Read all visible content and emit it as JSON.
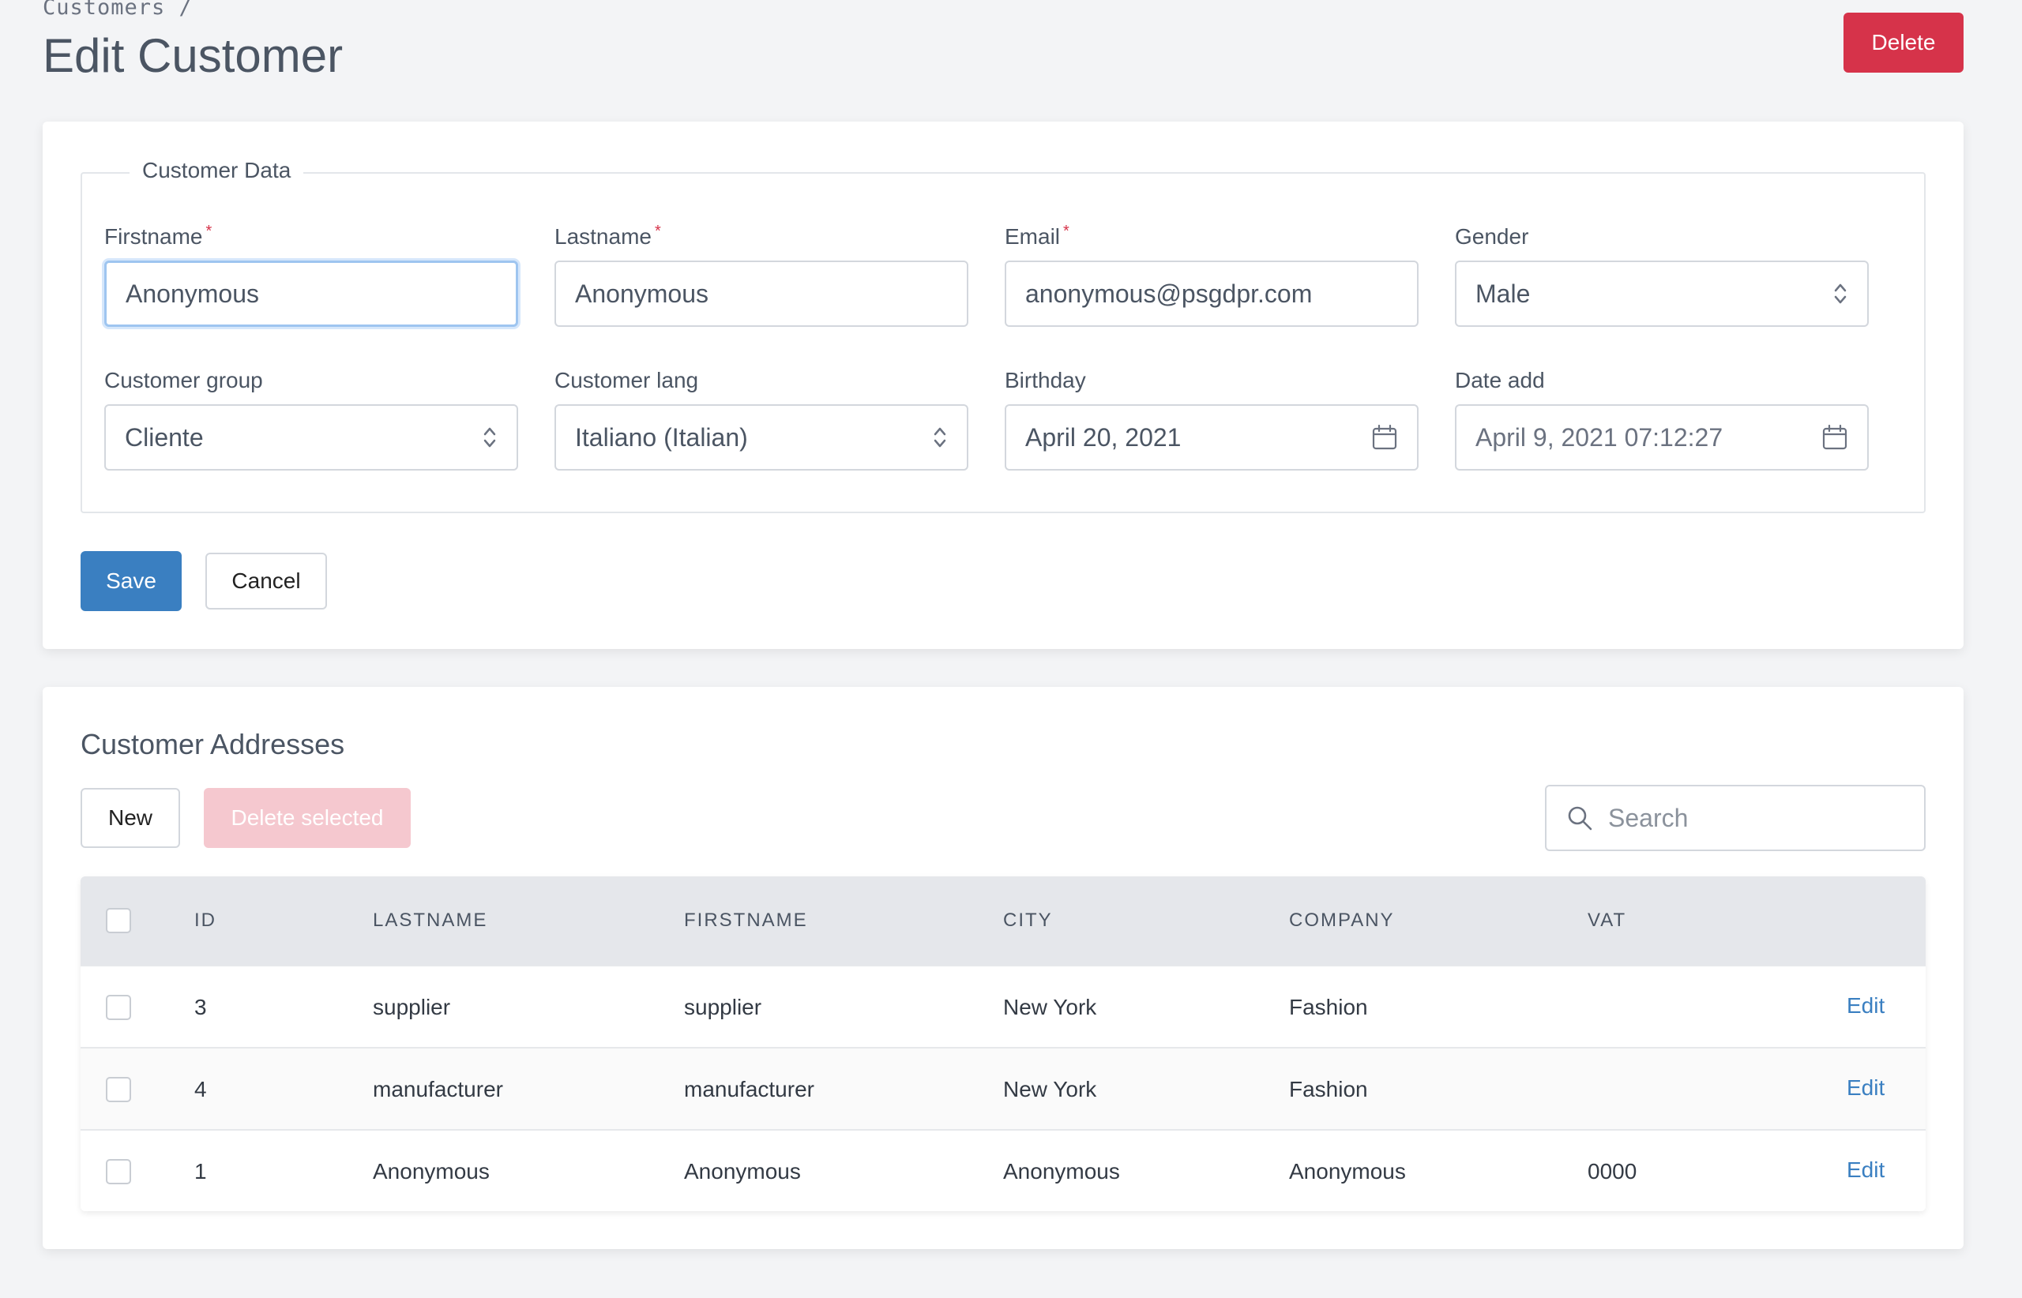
{
  "header": {
    "breadcrumb": "Customers /",
    "title": "Edit Customer",
    "delete_label": "Delete"
  },
  "customer_data": {
    "legend": "Customer Data",
    "firstname": {
      "label": "Firstname",
      "value": "Anonymous"
    },
    "lastname": {
      "label": "Lastname",
      "value": "Anonymous"
    },
    "email": {
      "label": "Email",
      "value": "anonymous@psgdpr.com"
    },
    "gender": {
      "label": "Gender",
      "value": "Male"
    },
    "customer_group": {
      "label": "Customer group",
      "value": "Cliente"
    },
    "customer_lang": {
      "label": "Customer lang",
      "value": "Italiano (Italian)"
    },
    "birthday": {
      "label": "Birthday",
      "value": "April 20, 2021"
    },
    "date_add": {
      "label": "Date add",
      "value": "April 9, 2021 07:12:27"
    },
    "required_mark": "*",
    "save_label": "Save",
    "cancel_label": "Cancel"
  },
  "addresses": {
    "title": "Customer Addresses",
    "new_label": "New",
    "delete_selected_label": "Delete selected",
    "search_placeholder": "Search",
    "columns": [
      "ID",
      "LASTNAME",
      "FIRSTNAME",
      "CITY",
      "COMPANY",
      "VAT"
    ],
    "rows": [
      {
        "id": "3",
        "lastname": "supplier",
        "firstname": "supplier",
        "city": "New York",
        "company": "Fashion",
        "vat": "",
        "action": "Edit"
      },
      {
        "id": "4",
        "lastname": "manufacturer",
        "firstname": "manufacturer",
        "city": "New York",
        "company": "Fashion",
        "vat": "",
        "action": "Edit"
      },
      {
        "id": "1",
        "lastname": "Anonymous",
        "firstname": "Anonymous",
        "city": "Anonymous",
        "company": "Anonymous",
        "vat": "0000",
        "action": "Edit"
      }
    ]
  },
  "colors": {
    "primary": "#3a7fc1",
    "danger": "#d6334a",
    "danger_disabled": "#f5c8cf",
    "background": "#f3f4f6"
  },
  "icons": {
    "select": "chevron-up-down-icon",
    "date": "calendar-icon",
    "search": "search-icon"
  }
}
